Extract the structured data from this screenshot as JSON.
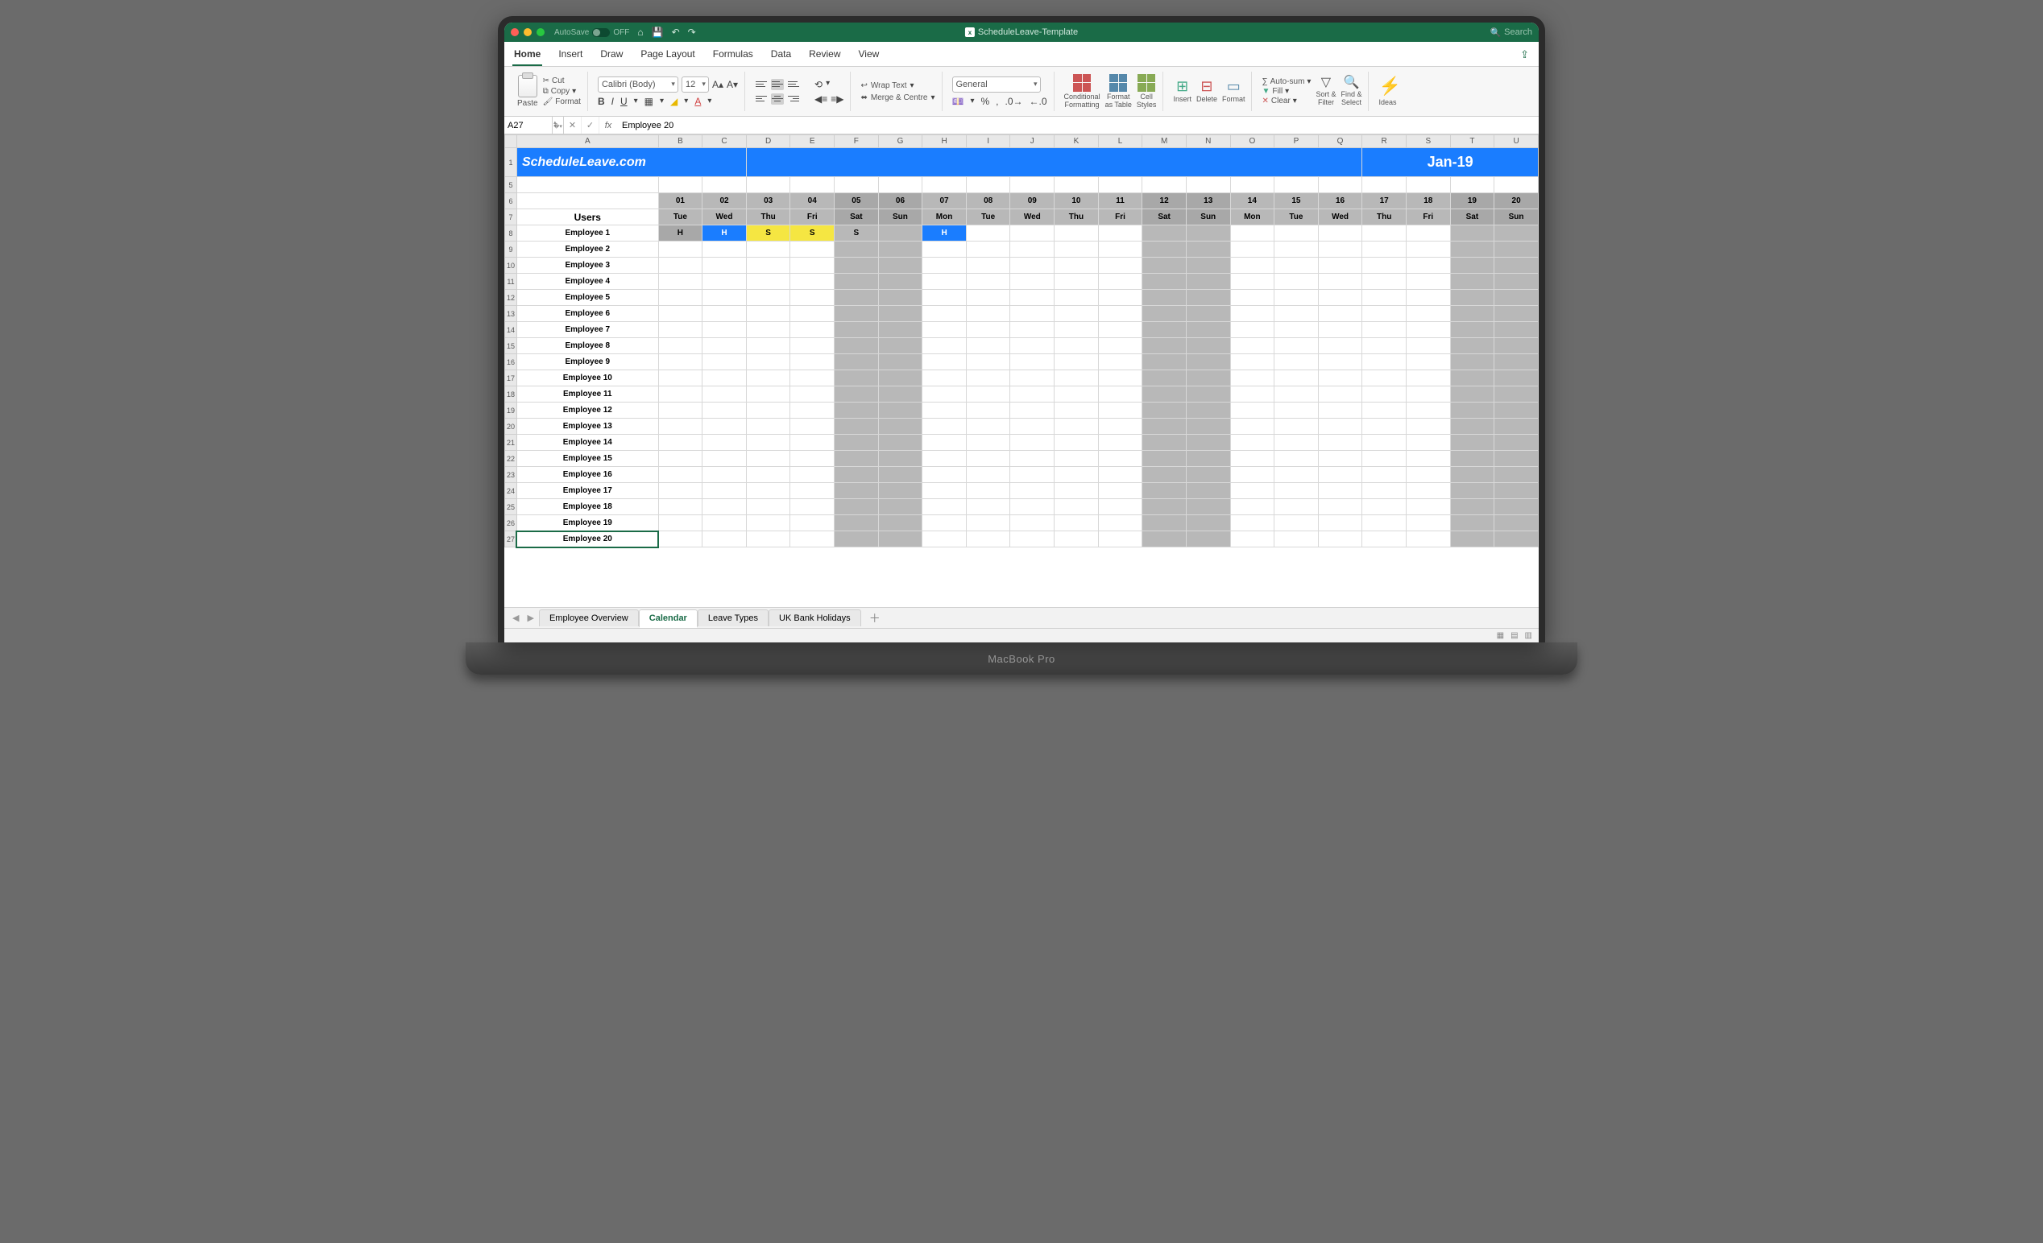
{
  "title": "ScheduleLeave-Template",
  "autosave": "AutoSave",
  "autosave_state": "OFF",
  "search": "Search",
  "tabs": [
    "Home",
    "Insert",
    "Draw",
    "Page Layout",
    "Formulas",
    "Data",
    "Review",
    "View"
  ],
  "active_tab": 0,
  "clipboard": {
    "paste": "Paste",
    "cut": "Cut",
    "copy": "Copy",
    "format": "Format"
  },
  "font": {
    "name": "Calibri (Body)",
    "size": "12"
  },
  "number_format": "General",
  "wrap": "Wrap Text",
  "merge": "Merge & Centre",
  "cf": "Conditional\nFormatting",
  "fat": "Format\nas Table",
  "cs": "Cell\nStyles",
  "ins": "Insert",
  "del": "Delete",
  "fmt": "Format",
  "autosum": "Auto-sum",
  "fill": "Fill",
  "clear": "Clear",
  "sort": "Sort &\nFilter",
  "find": "Find &\nSelect",
  "ideas": "Ideas",
  "namebox": "A27",
  "formula": "Employee 20",
  "cols": [
    "A",
    "B",
    "C",
    "D",
    "E",
    "F",
    "G",
    "H",
    "I",
    "J",
    "K",
    "L",
    "M",
    "N",
    "O",
    "P",
    "Q",
    "R",
    "S",
    "T",
    "U"
  ],
  "banner_left": "ScheduleLeave.com",
  "banner_right": "Jan-19",
  "days": [
    {
      "n": "01",
      "d": "Tue",
      "w": false
    },
    {
      "n": "02",
      "d": "Wed",
      "w": false
    },
    {
      "n": "03",
      "d": "Thu",
      "w": false
    },
    {
      "n": "04",
      "d": "Fri",
      "w": false
    },
    {
      "n": "05",
      "d": "Sat",
      "w": true
    },
    {
      "n": "06",
      "d": "Sun",
      "w": true
    },
    {
      "n": "07",
      "d": "Mon",
      "w": false
    },
    {
      "n": "08",
      "d": "Tue",
      "w": false
    },
    {
      "n": "09",
      "d": "Wed",
      "w": false
    },
    {
      "n": "10",
      "d": "Thu",
      "w": false
    },
    {
      "n": "11",
      "d": "Fri",
      "w": false
    },
    {
      "n": "12",
      "d": "Sat",
      "w": true
    },
    {
      "n": "13",
      "d": "Sun",
      "w": true
    },
    {
      "n": "14",
      "d": "Mon",
      "w": false
    },
    {
      "n": "15",
      "d": "Tue",
      "w": false
    },
    {
      "n": "16",
      "d": "Wed",
      "w": false
    },
    {
      "n": "17",
      "d": "Thu",
      "w": false
    },
    {
      "n": "18",
      "d": "Fri",
      "w": false
    },
    {
      "n": "19",
      "d": "Sat",
      "w": true
    },
    {
      "n": "20",
      "d": "Sun",
      "w": true
    }
  ],
  "users_label": "Users",
  "employees": [
    "Employee 1",
    "Employee 2",
    "Employee 3",
    "Employee 4",
    "Employee 5",
    "Employee 6",
    "Employee 7",
    "Employee 8",
    "Employee 9",
    "Employee 10",
    "Employee 11",
    "Employee 12",
    "Employee 13",
    "Employee 14",
    "Employee 15",
    "Employee 16",
    "Employee 17",
    "Employee 18",
    "Employee 19",
    "Employee 20"
  ],
  "emp1_marks": {
    "0": "Hg",
    "1": "H",
    "2": "S",
    "3": "S",
    "4": "Sg",
    "6": "H"
  },
  "sheet_tabs": [
    "Employee Overview",
    "Calendar",
    "Leave Types",
    "UK Bank Holidays"
  ],
  "active_sheet": 1,
  "laptop": "MacBook Pro"
}
